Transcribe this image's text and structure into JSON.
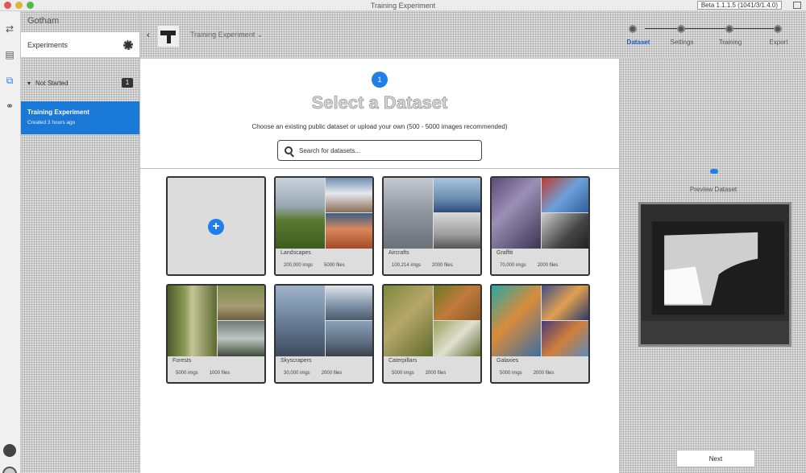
{
  "window": {
    "title": "Training Experiment",
    "build": "Beta 1.1.1.5 (1041/3/1.4.0)"
  },
  "sidebar": {
    "header": "Gotham",
    "experiments_label": "Experiments",
    "group_label": "Not Started",
    "group_count": "1",
    "selected_item": {
      "title": "Training Experiment",
      "subtitle": "Created 3 hours ago"
    }
  },
  "topbar": {
    "experiment_name": "Training Experiment",
    "steps": [
      {
        "label": "Dataset",
        "active": true
      },
      {
        "label": "Settings",
        "active": false
      },
      {
        "label": "Training",
        "active": false
      },
      {
        "label": "Export",
        "active": false
      }
    ]
  },
  "main": {
    "step_number": "1",
    "title": "Select a Dataset",
    "subtitle": "Choose an existing public dataset or upload your own (500 - 5000 images recommended)",
    "search_placeholder": "Search for datasets...",
    "datasets": [
      {
        "name": "Landscapes",
        "images": "200,000 imgs",
        "size": "5000 files"
      },
      {
        "name": "Aircrafts",
        "images": "100,214 imgs",
        "size": "2000 files"
      },
      {
        "name": "Graffiti",
        "images": "70,000 imgs",
        "size": "2000 files"
      },
      {
        "name": "Forests",
        "images": "5000 imgs",
        "size": "1000 files"
      },
      {
        "name": "Skyscrapers",
        "images": "30,000 imgs",
        "size": "2000 files"
      },
      {
        "name": "Caterpillars",
        "images": "5000 imgs",
        "size": "2000 files"
      },
      {
        "name": "Galaxies",
        "images": "5000 imgs",
        "size": "2000 files"
      }
    ]
  },
  "preview": {
    "label": "Preview Dataset",
    "next_label": "Next"
  },
  "colors": {
    "accent": "#1f7ee8",
    "selected": "#1a78d6"
  }
}
